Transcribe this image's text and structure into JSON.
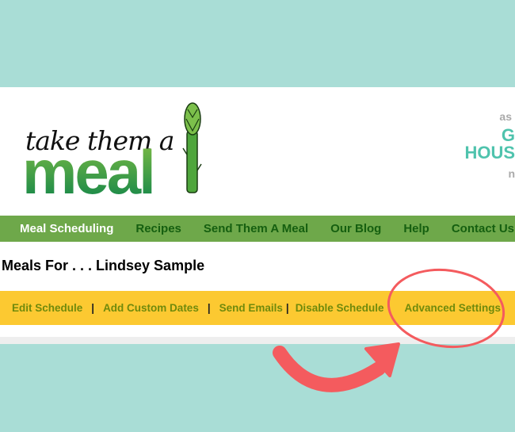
{
  "logo": {
    "tagline": "take them a",
    "word": "meal"
  },
  "partner_logo": {
    "line1": "as",
    "line2": "G",
    "line3": "HOUS",
    "line4": "n"
  },
  "nav": {
    "items": [
      {
        "label": "Meal Scheduling",
        "active": true
      },
      {
        "label": "Recipes"
      },
      {
        "label": "Send Them A Meal"
      },
      {
        "label": "Our Blog"
      },
      {
        "label": "Help"
      },
      {
        "label": "Contact Us"
      }
    ]
  },
  "page_title": "Meals For . . . Lindsey Sample",
  "subnav": {
    "items": [
      "Edit Schedule",
      "Add Custom Dates",
      "Send Emails",
      "Disable Schedule",
      "Advanced Settings"
    ],
    "separator": "|"
  },
  "colors": {
    "background": "#a9ddd6",
    "nav": "#6ea84a",
    "subnav": "#fcc931",
    "annotation": "#f45b5e"
  }
}
